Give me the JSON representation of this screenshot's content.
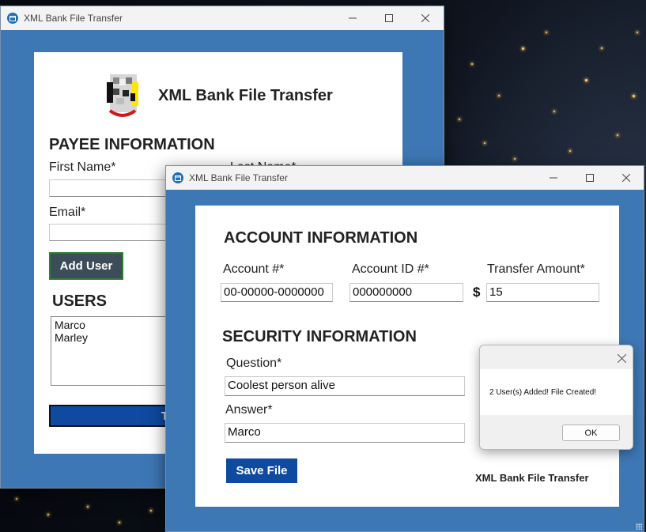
{
  "back_window": {
    "title": "XML Bank File Transfer",
    "header": "XML Bank File Transfer",
    "payee_heading": "PAYEE INFORMATION",
    "first_name_label": "First Name*",
    "last_name_label": "Last Name*",
    "email_label": "Email*",
    "add_user_button": "Add User",
    "users_heading": "USERS",
    "users": [
      "Marco",
      "Marley"
    ],
    "transfer_button": "T"
  },
  "front_window": {
    "title": "XML Bank File Transfer",
    "account_heading": "ACCOUNT INFORMATION",
    "account_no_label": "Account #*",
    "account_no_value": "00-00000-0000000",
    "account_id_label": "Account ID #*",
    "account_id_value": "000000000",
    "currency_symbol": "$",
    "transfer_amount_label": "Transfer Amount*",
    "transfer_amount_value": "15",
    "security_heading": "SECURITY INFORMATION",
    "question_label": "Question*",
    "question_value": "Coolest person alive",
    "answer_label": "Answer*",
    "answer_value": "Marco",
    "save_button": "Save File",
    "footer_brand": "XML Bank File Transfer"
  },
  "dialog": {
    "message": "2 User(s) Added! File Created!",
    "ok_button": "OK"
  },
  "colors": {
    "window_frame": "#3d77b4",
    "primary_button": "#0d4aa0",
    "add_user_button": "#3c4c59"
  }
}
